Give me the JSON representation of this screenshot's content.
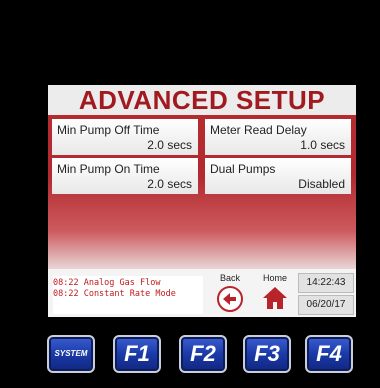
{
  "screen": {
    "title": "ADVANCED SETUP",
    "fields": [
      {
        "label": "Min Pump Off Time",
        "value": "2.0 secs"
      },
      {
        "label": "Meter Read Delay",
        "value": "1.0 secs"
      },
      {
        "label": "Min Pump On Time",
        "value": "2.0 secs"
      },
      {
        "label": "Dual Pumps",
        "value": "Disabled"
      }
    ]
  },
  "footer": {
    "log": [
      "08:22 Analog Gas Flow",
      "08:22 Constant Rate Mode"
    ],
    "back_label": "Back",
    "home_label": "Home",
    "time": "14:22:43",
    "date": "06/20/17"
  },
  "keys": {
    "system": "SYSTEM",
    "f1": "F1",
    "f2": "F2",
    "f3": "F3",
    "f4": "F4"
  },
  "colors": {
    "accent_red": "#a11a1f",
    "key_blue": "#1b3aa8"
  },
  "icons": {
    "back": "arrow-left-circle-icon",
    "home": "home-icon"
  }
}
